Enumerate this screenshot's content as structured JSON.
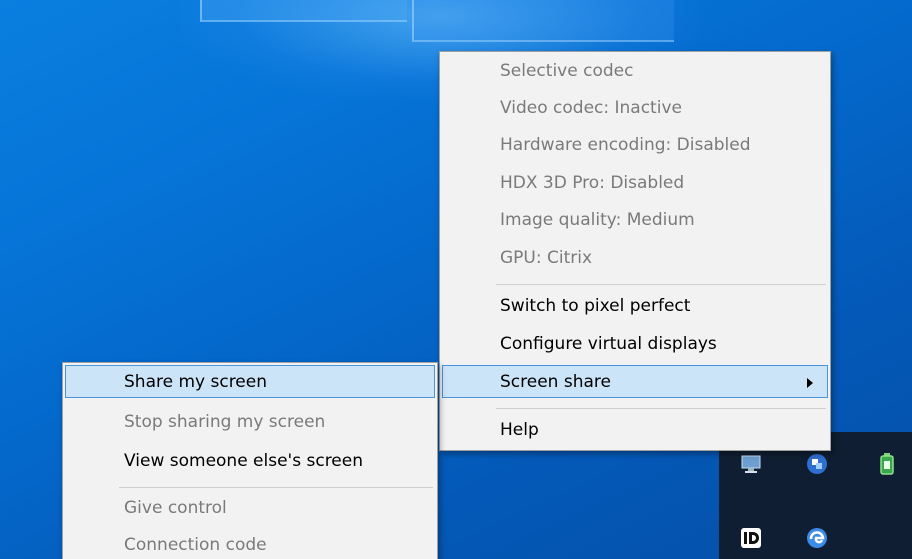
{
  "main_menu": {
    "items": [
      {
        "label": "Selective codec"
      },
      {
        "label": "Video codec: Inactive"
      },
      {
        "label": "Hardware encoding: Disabled"
      },
      {
        "label": "HDX 3D Pro: Disabled"
      },
      {
        "label": "Image quality: Medium"
      },
      {
        "label": "GPU: Citrix"
      },
      {
        "label": "Switch to pixel perfect"
      },
      {
        "label": "Configure virtual displays"
      },
      {
        "label": "Screen share"
      },
      {
        "label": "Help"
      }
    ]
  },
  "submenu": {
    "items": [
      {
        "label": "Share my screen"
      },
      {
        "label": "Stop sharing my screen"
      },
      {
        "label": "View someone else's screen"
      },
      {
        "label": "Give control"
      },
      {
        "label": "Connection code"
      }
    ]
  },
  "tray": {
    "icons": [
      "monitor-icon",
      "connection-icon",
      "battery-icon",
      "id-app-icon",
      "edge-icon"
    ]
  }
}
